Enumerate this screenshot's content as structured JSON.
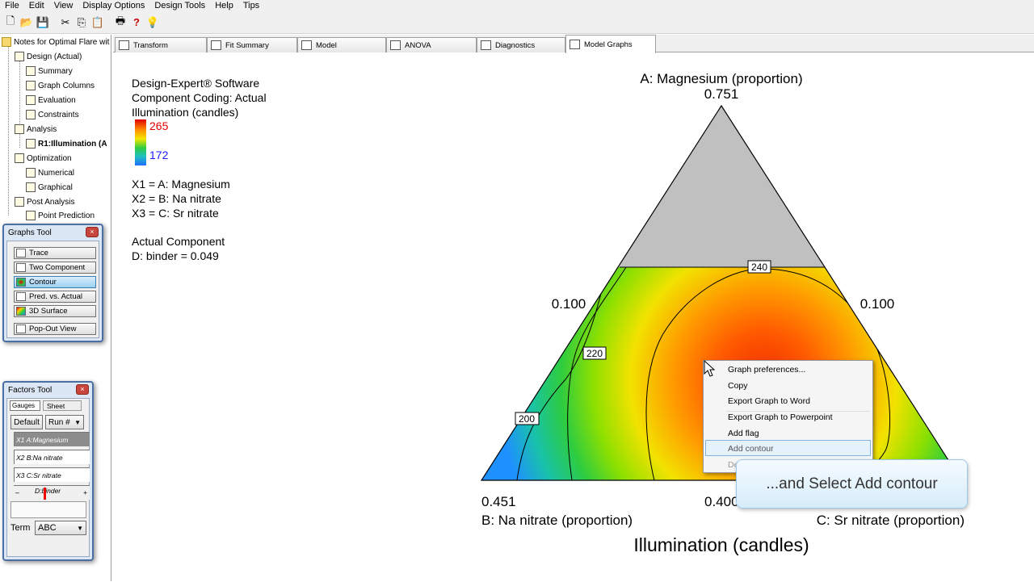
{
  "menu": [
    "File",
    "Edit",
    "View",
    "Display Options",
    "Design Tools",
    "Help",
    "Tips"
  ],
  "toolbar": [
    "new-icon",
    "open-icon",
    "save-icon",
    "cut-icon",
    "copy-icon",
    "paste-icon",
    "print-icon",
    "help-icon",
    "tip-bulb-icon"
  ],
  "tree": {
    "root": "Notes for Optimal Flare wit",
    "design": "Design (Actual)",
    "summary": "Summary",
    "graph_columns": "Graph Columns",
    "evaluation": "Evaluation",
    "constraints": "Constraints",
    "analysis": "Analysis",
    "r1": "R1:Illumination (A",
    "optimization": "Optimization",
    "numerical": "Numerical",
    "graphical": "Graphical",
    "post_analysis": "Post Analysis",
    "point_prediction": "Point Prediction"
  },
  "graphs_tool": {
    "title": "Graphs Tool",
    "close": "×",
    "buttons": [
      "Trace",
      "Two Component",
      "Contour",
      "Pred. vs. Actual",
      "3D Surface"
    ],
    "popout": "Pop-Out View"
  },
  "factors_tool": {
    "title": "Factors Tool",
    "close": "×",
    "tab_gauges": "Gauges",
    "tab_sheet": "Sheet",
    "default_btn": "Default",
    "run_select": "Run #",
    "factors": [
      "X1 A:Magnesium",
      "X2 B:Na nitrate",
      "X3 C:Sr nitrate"
    ],
    "binder_label": "D:binder",
    "minus": "–",
    "plus": "+",
    "term_label": "Term",
    "term_value": "ABC"
  },
  "tabs": [
    "Transform",
    "Fit Summary",
    "Model",
    "ANOVA",
    "Diagnostics",
    "Model Graphs"
  ],
  "info": {
    "line1": "Design-Expert® Software",
    "line2": "Component Coding: Actual",
    "line3": "Illumination (candles)",
    "legend_high": "265",
    "legend_low": "172",
    "x1": "X1 = A: Magnesium",
    "x2": "X2 = B: Na nitrate",
    "x3": "X3 = C: Sr nitrate",
    "actual_component": "Actual Component",
    "binder": "D: binder = 0.049"
  },
  "chart_data": {
    "type": "ternary-contour",
    "title": "Illumination (candles)",
    "vertices": [
      {
        "label": "A: Magnesium (proportion)",
        "value": "0.751"
      },
      {
        "label": "B: Na nitrate (proportion)",
        "value": "0.451"
      },
      {
        "label": "C: Sr nitrate (proportion)",
        "value": "0.400"
      }
    ],
    "side_ticks": [
      "0.100",
      "0.100"
    ],
    "contour_labels": [
      "200",
      "220",
      "240"
    ],
    "color_range": [
      172,
      265
    ],
    "colors": {
      "high": "#e00000",
      "mid": "#2ecc40",
      "low": "#1e90ff",
      "infeasible": "#c0c0c0"
    }
  },
  "context_menu": {
    "items": [
      "Graph preferences...",
      "Copy",
      "Export Graph to Word",
      "Export Graph to Powerpoint",
      "Add flag",
      "Add contour",
      "De"
    ],
    "highlighted": "Add contour"
  },
  "callout": "...and Select Add contour"
}
